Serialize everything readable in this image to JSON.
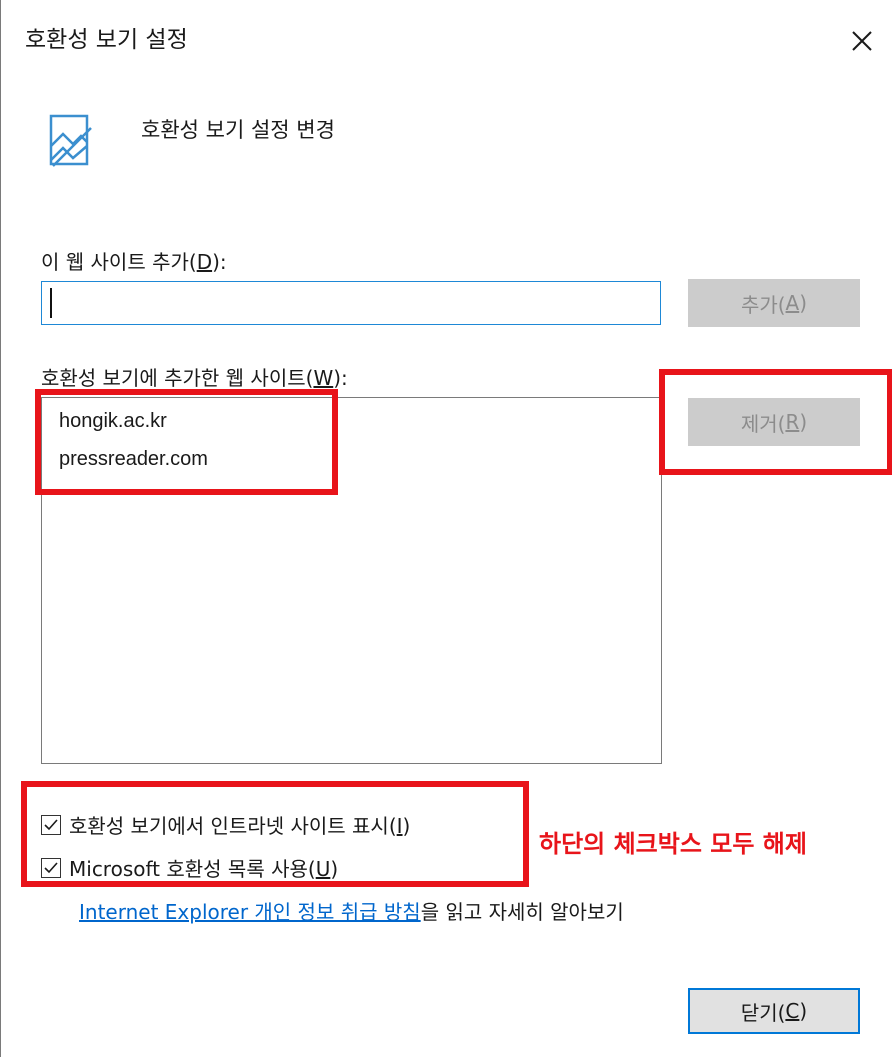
{
  "window": {
    "title": "호환성 보기 설정"
  },
  "header": {
    "text": "호환성 보기 설정 변경"
  },
  "add_site": {
    "label_prefix": "이 웹 사이트 추가(",
    "label_key": "D",
    "label_suffix": "):",
    "input_value": "",
    "add_button_prefix": "추가(",
    "add_button_key": "A",
    "add_button_suffix": ")"
  },
  "site_list": {
    "label_prefix": "호환성 보기에 추가한 웹 사이트(",
    "label_key": "W",
    "label_suffix": "):",
    "items": [
      "hongik.ac.kr",
      "pressreader.com"
    ],
    "remove_button_prefix": "제거(",
    "remove_button_key": "R",
    "remove_button_suffix": ")"
  },
  "options": [
    {
      "prefix": "호환성 보기에서 인트라넷 사이트 표시(",
      "key": "I",
      "suffix": ")",
      "checked": true
    },
    {
      "prefix": "Microsoft 호환성 목록 사용(",
      "key": "U",
      "suffix": ")",
      "checked": true
    }
  ],
  "privacy": {
    "link_text": "Internet Explorer 개인 정보 취급 방침",
    "trailing_text": "을 읽고 자세히 알아보기"
  },
  "close_button": {
    "prefix": "닫기(",
    "key": "C",
    "suffix": ")"
  },
  "annotation": {
    "text": "하단의 체크박스 모두 해제",
    "color": "#e8141a"
  },
  "colors": {
    "accent": "#0078d7",
    "link": "#0066cc",
    "disabled_bg": "#cccccc"
  }
}
